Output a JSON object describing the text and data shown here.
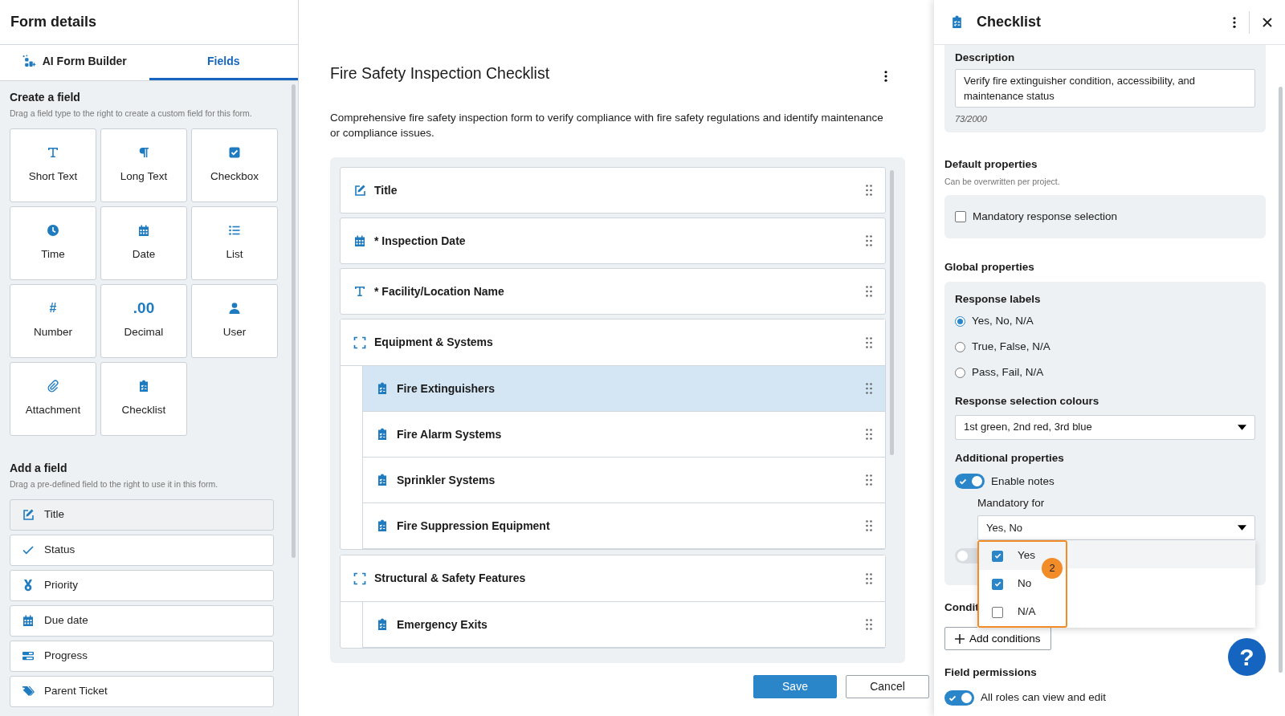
{
  "header": {
    "title": "Form details"
  },
  "left_tabs": [
    {
      "label": "AI Form Builder",
      "kind": "ai",
      "selected": false
    },
    {
      "label": "Fields",
      "kind": "plain",
      "selected": true
    }
  ],
  "create_section": {
    "title": "Create a field",
    "hint": "Drag a field type to the right to create a custom field for this form."
  },
  "field_types": [
    {
      "label": "Short Text",
      "kind": "short_text"
    },
    {
      "label": "Long Text",
      "kind": "long_text"
    },
    {
      "label": "Checkbox",
      "kind": "checkbox"
    },
    {
      "label": "Time",
      "kind": "time"
    },
    {
      "label": "Date",
      "kind": "date"
    },
    {
      "label": "List",
      "kind": "list"
    },
    {
      "label": "Number",
      "kind": "number",
      "glyph": "#"
    },
    {
      "label": "Decimal",
      "kind": "decimal",
      "glyph": ".00"
    },
    {
      "label": "User",
      "kind": "user"
    },
    {
      "label": "Attachment",
      "kind": "attachment"
    },
    {
      "label": "Checklist",
      "kind": "checklist"
    }
  ],
  "add_section": {
    "title": "Add a field",
    "hint": "Drag a pre-defined field to the right to use it in this form."
  },
  "predefined_fields": [
    {
      "label": "Title",
      "kind": "edit",
      "highlighted": true
    },
    {
      "label": "Status",
      "kind": "check",
      "highlighted": false
    },
    {
      "label": "Priority",
      "kind": "medal",
      "highlighted": false
    },
    {
      "label": "Due date",
      "kind": "date",
      "highlighted": false
    },
    {
      "label": "Progress",
      "kind": "progress",
      "highlighted": false
    },
    {
      "label": "Parent Ticket",
      "kind": "tag",
      "highlighted": false
    }
  ],
  "form": {
    "title": "Fire Safety Inspection Checklist",
    "description": "Comprehensive fire safety inspection form to verify compliance with fire safety regulations and identify maintenance or compliance issues.",
    "items": [
      {
        "label": "Title",
        "kind": "edit",
        "selected": false
      },
      {
        "label": "* Inspection Date",
        "kind": "date",
        "selected": false
      },
      {
        "label": "* Facility/Location Name",
        "kind": "short_text",
        "selected": false
      },
      {
        "label": "Equipment & Systems",
        "kind": "section",
        "selected": false,
        "children": [
          {
            "label": "Fire Extinguishers",
            "kind": "checklist",
            "selected": true
          },
          {
            "label": "Fire Alarm Systems",
            "kind": "checklist",
            "selected": false
          },
          {
            "label": "Sprinkler Systems",
            "kind": "checklist",
            "selected": false
          },
          {
            "label": "Fire Suppression Equipment",
            "kind": "checklist",
            "selected": false
          }
        ]
      },
      {
        "label": "Structural & Safety Features",
        "kind": "section",
        "selected": false,
        "children": [
          {
            "label": "Emergency Exits",
            "kind": "checklist",
            "selected": false
          }
        ]
      }
    ]
  },
  "actions": [
    {
      "label": "Save",
      "kind": "primary"
    },
    {
      "label": "Cancel",
      "kind": "secondary"
    }
  ],
  "side_panel": {
    "title": "Checklist",
    "description": {
      "label": "Description",
      "value": "Verify fire extinguisher condition, accessibility, and maintenance status",
      "counter": "73/2000"
    },
    "default_properties": {
      "title": "Default properties",
      "hint": "Can be overwritten per project.",
      "options": [
        {
          "label": "Mandatory response selection",
          "checked": false
        }
      ]
    },
    "global_properties": {
      "title": "Global properties",
      "response_labels": {
        "title": "Response labels",
        "options": [
          {
            "label": "Yes, No, N/A",
            "selected": true
          },
          {
            "label": "True, False, N/A",
            "selected": false
          },
          {
            "label": "Pass, Fail, N/A",
            "selected": false
          }
        ]
      },
      "colours": {
        "label": "Response selection colours",
        "value": "1st green, 2nd red, 3rd blue"
      },
      "additional": {
        "title": "Additional properties",
        "toggles": [
          {
            "label": "Enable notes",
            "on": true
          },
          {
            "on": false
          }
        ],
        "mandatory_for": {
          "label": "Mandatory for",
          "value": "Yes, No",
          "options": [
            {
              "label": "Yes",
              "checked": true,
              "hovered": true
            },
            {
              "label": "No",
              "checked": true,
              "hovered": false
            },
            {
              "label": "N/A",
              "checked": false,
              "hovered": false
            }
          ]
        }
      }
    },
    "conditions": {
      "title": "Condit",
      "button": "Add conditions"
    },
    "permissions": {
      "title": "Field permissions",
      "toggle": {
        "label": "All roles can view and edit",
        "on": true
      }
    }
  },
  "annotation_badge": "2",
  "help_button": "?"
}
